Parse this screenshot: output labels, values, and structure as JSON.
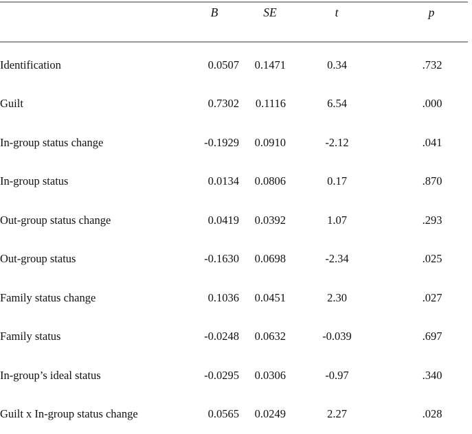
{
  "table": {
    "name": "regression-results-table",
    "columns": [
      {
        "key": "label",
        "header": ""
      },
      {
        "key": "B",
        "header": "B"
      },
      {
        "key": "SE",
        "header": "SE"
      },
      {
        "key": "t",
        "header": "t"
      },
      {
        "key": "p",
        "header": "p"
      }
    ],
    "rows": [
      {
        "label": "Identification",
        "B": "0.0507",
        "SE": "0.1471",
        "t": "0.34",
        "p": ".732"
      },
      {
        "label": "Guilt",
        "B": "0.7302",
        "SE": "0.1116",
        "t": "6.54",
        "p": ".000"
      },
      {
        "label": "In-group status change",
        "B": "-0.1929",
        "SE": "0.0910",
        "t": "-2.12",
        "p": ".041"
      },
      {
        "label": "In-group status",
        "B": "0.0134",
        "SE": "0.0806",
        "t": "0.17",
        "p": ".870"
      },
      {
        "label": "Out-group status change",
        "B": "0.0419",
        "SE": "0.0392",
        "t": "1.07",
        "p": ".293"
      },
      {
        "label": "Out-group status",
        "B": "-0.1630",
        "SE": "0.0698",
        "t": "-2.34",
        "p": ".025"
      },
      {
        "label": "Family status change",
        "B": "0.1036",
        "SE": "0.0451",
        "t": "2.30",
        "p": ".027"
      },
      {
        "label": "Family status",
        "B": "-0.0248",
        "SE": "0.0632",
        "t": "-0.039",
        "p": ".697"
      },
      {
        "label": "In-group’s ideal status",
        "B": "-0.0295",
        "SE": "0.0306",
        "t": "-0.97",
        "p": ".340"
      },
      {
        "label": "Guilt x In-group status change",
        "B": "0.0565",
        "SE": "0.0249",
        "t": "2.27",
        "p": ".028"
      }
    ]
  },
  "style": {
    "rule_color": "#9a9a9a",
    "text_color": "#111111",
    "background": "#ffffff"
  }
}
